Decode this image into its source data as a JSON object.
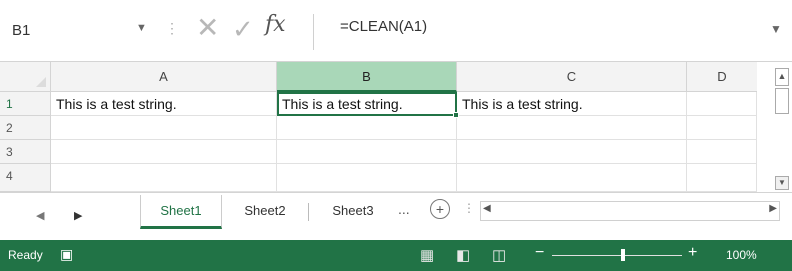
{
  "formula_bar": {
    "name_box": "B1",
    "cancel_icon": "close-icon",
    "enter_icon": "check-icon",
    "function_label": "fx",
    "content": "=CLEAN(A1)"
  },
  "columns": [
    "A",
    "B",
    "C",
    "D"
  ],
  "rows": [
    "1",
    "2",
    "3",
    "4"
  ],
  "cells": {
    "A1": "This is a test    string.",
    "B1": "This is a test string.",
    "C1": "This is a test    string.",
    "D1": ""
  },
  "sheet_tabs": [
    "Sheet1",
    "Sheet2",
    "Sheet3"
  ],
  "active_sheet": "Sheet1",
  "tab_more": "...",
  "status": {
    "mode": "Ready",
    "zoom": "100%"
  },
  "colors": {
    "accent": "#217346",
    "active_header": "#a9d7b8"
  }
}
